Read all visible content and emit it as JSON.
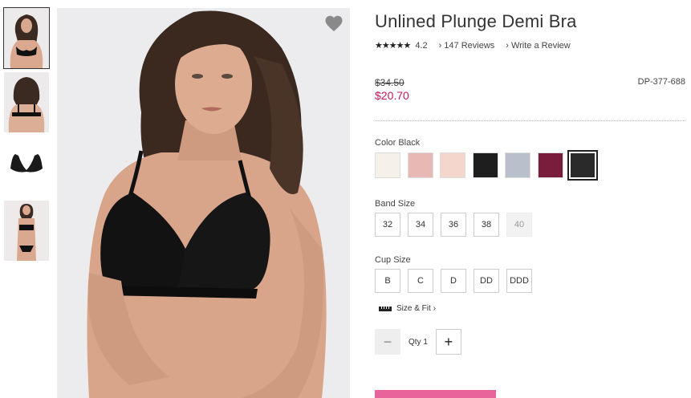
{
  "product": {
    "title": "Unlined Plunge Demi Bra",
    "stars": "★★★★★",
    "rating": "4.2",
    "reviews_link": "147 Reviews",
    "write_review_link": "Write a Review",
    "original_price": "$34.50",
    "sale_price": "$20.70",
    "sku": "DP-377-688"
  },
  "color": {
    "label": "Color Black",
    "swatches": [
      {
        "name": "ivory",
        "hex": "#f5f0ea"
      },
      {
        "name": "pink-lace",
        "hex": "#e8b8b4"
      },
      {
        "name": "blush",
        "hex": "#f4d6cc"
      },
      {
        "name": "black-lace",
        "hex": "#1e1e1e"
      },
      {
        "name": "grey-blue",
        "hex": "#b9c0cc"
      },
      {
        "name": "berry-lace",
        "hex": "#7a1d3c"
      },
      {
        "name": "black",
        "hex": "#2a2a2a"
      }
    ],
    "selected_index": 6
  },
  "band": {
    "label": "Band Size",
    "sizes": [
      "32",
      "34",
      "36",
      "38",
      "40"
    ],
    "unavailable": [
      "40"
    ]
  },
  "cup": {
    "label": "Cup Size",
    "sizes": [
      "B",
      "C",
      "D",
      "DD",
      "DDD"
    ]
  },
  "size_fit": {
    "label": "Size & Fit",
    "chevron": "›"
  },
  "quantity": {
    "label": "Qty 1",
    "minus": "−",
    "plus": "+"
  },
  "icons": {
    "favorite": "heart-icon",
    "ruler": "ruler-icon",
    "chevron": "chevron-right-icon"
  },
  "accent_colors": {
    "sale": "#c2185b",
    "add_to_bag": "#e8649a"
  }
}
